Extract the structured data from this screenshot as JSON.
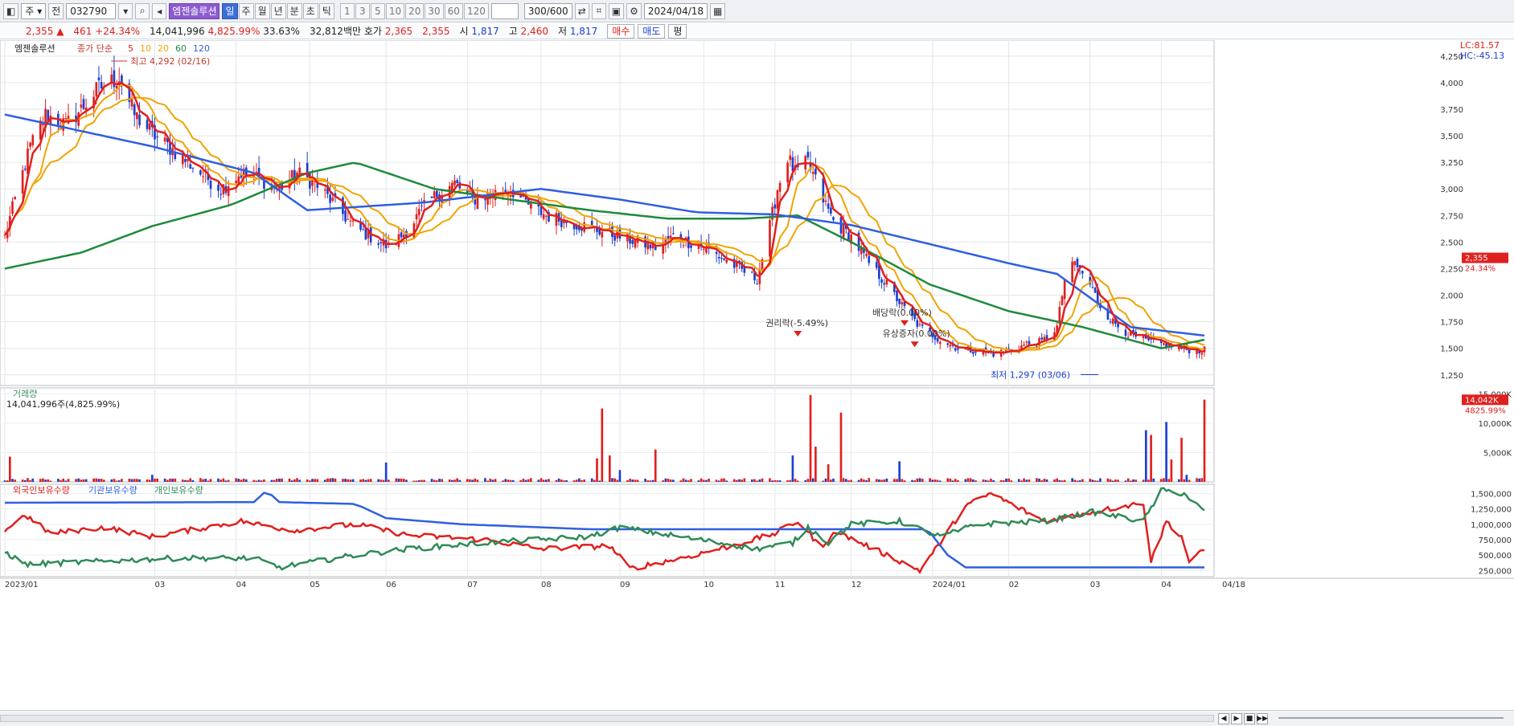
{
  "toolbar": {
    "period_label": "주",
    "compare_label": "전",
    "code": "032790",
    "stock_name": "엠젠솔루션",
    "period_tabs": [
      "일",
      "주",
      "월",
      "년",
      "분",
      "초",
      "틱"
    ],
    "interval_buttons": [
      "1",
      "3",
      "5",
      "10",
      "20",
      "30",
      "60",
      "120"
    ],
    "count": "300/600",
    "date": "2024/04/18"
  },
  "quote": {
    "price": "2,355",
    "change": "461",
    "change_pct": "+24.34%",
    "volume": "14,041,996",
    "volume_pct": "4,825.99%",
    "turnover": "33.63%",
    "amount": "32,812백만",
    "bid_label": "호가",
    "ask": "2,365",
    "bid": "2,355",
    "open_label": "시",
    "open": "1,817",
    "high_label": "고",
    "high": "2,460",
    "low_label": "저",
    "low": "1,817",
    "buy_label": "매수",
    "sell_label": "매도",
    "avg_label": "평"
  },
  "chart_data": [
    {
      "type": "candlestick",
      "panel": "price",
      "title": "엠젠솔루션",
      "legend": [
        {
          "name": "종가 단순",
          "color": "#c0392b"
        },
        {
          "name": "5",
          "color": "#e0201e"
        },
        {
          "name": "10",
          "color": "#f0a400"
        },
        {
          "name": "20",
          "color": "#f0a400"
        },
        {
          "name": "60",
          "color": "#1e8a3c"
        },
        {
          "name": "120",
          "color": "#2f5fe0"
        }
      ],
      "ylim": [
        1150,
        4400
      ],
      "yticks": [
        1250,
        1500,
        1750,
        2000,
        2250,
        2500,
        2750,
        3000,
        3250,
        3500,
        3750,
        4000,
        4250
      ],
      "ytick_labels": [
        "1,250",
        "1,500",
        "1,750",
        "2,000",
        "2,250",
        "2,500",
        "2,750",
        "3,000",
        "3,250",
        "3,500",
        "3,750",
        "4,000",
        "4,250"
      ],
      "x_labels": [
        "2023/01",
        "03",
        "04",
        "05",
        "06",
        "07",
        "08",
        "09",
        "10",
        "11",
        "12",
        "2024/01",
        "02",
        "03",
        "04",
        "04/18"
      ],
      "close_anchors": [
        [
          "2023-01-02",
          2550
        ],
        [
          "2023-01-06",
          2900
        ],
        [
          "2023-01-12",
          3400
        ],
        [
          "2023-01-18",
          3700
        ],
        [
          "2023-01-26",
          3600
        ],
        [
          "2023-02-01",
          3750
        ],
        [
          "2023-02-08",
          3950
        ],
        [
          "2023-02-16",
          4050
        ],
        [
          "2023-02-22",
          3700
        ],
        [
          "2023-03-02",
          3500
        ],
        [
          "2023-03-10",
          3350
        ],
        [
          "2023-03-20",
          3150
        ],
        [
          "2023-03-28",
          3000
        ],
        [
          "2023-04-05",
          3150
        ],
        [
          "2023-04-12",
          3100
        ],
        [
          "2023-04-20",
          3000
        ],
        [
          "2023-04-27",
          3150
        ],
        [
          "2023-05-04",
          3050
        ],
        [
          "2023-05-12",
          2850
        ],
        [
          "2023-05-19",
          2650
        ],
        [
          "2023-05-26",
          2550
        ],
        [
          "2023-06-02",
          2450
        ],
        [
          "2023-06-09",
          2600
        ],
        [
          "2023-06-15",
          2800
        ],
        [
          "2023-06-21",
          2950
        ],
        [
          "2023-06-28",
          3050
        ],
        [
          "2023-07-05",
          2900
        ],
        [
          "2023-07-12",
          2950
        ],
        [
          "2023-07-20",
          3000
        ],
        [
          "2023-07-27",
          2850
        ],
        [
          "2023-08-03",
          2750
        ],
        [
          "2023-08-10",
          2700
        ],
        [
          "2023-08-18",
          2650
        ],
        [
          "2023-08-25",
          2600
        ],
        [
          "2023-09-01",
          2550
        ],
        [
          "2023-09-08",
          2500
        ],
        [
          "2023-09-15",
          2450
        ],
        [
          "2023-09-22",
          2550
        ],
        [
          "2023-10-04",
          2450
        ],
        [
          "2023-10-11",
          2350
        ],
        [
          "2023-10-18",
          2250
        ],
        [
          "2023-10-25",
          2150
        ],
        [
          "2023-10-30",
          2650
        ],
        [
          "2023-11-02",
          3000
        ],
        [
          "2023-11-06",
          3300
        ],
        [
          "2023-11-09",
          3150
        ],
        [
          "2023-11-14",
          3250
        ],
        [
          "2023-11-20",
          2900
        ],
        [
          "2023-11-24",
          2700
        ],
        [
          "2023-12-01",
          2550
        ],
        [
          "2023-12-08",
          2300
        ],
        [
          "2023-12-15",
          2100
        ],
        [
          "2023-12-21",
          1900
        ],
        [
          "2023-12-28",
          1700
        ],
        [
          "2024-01-05",
          1580
        ],
        [
          "2024-01-12",
          1500
        ],
        [
          "2024-01-19",
          1480
        ],
        [
          "2024-01-26",
          1450
        ],
        [
          "2024-02-02",
          1480
        ],
        [
          "2024-02-08",
          1540
        ],
        [
          "2024-02-14",
          1560
        ],
        [
          "2024-02-20",
          1700
        ],
        [
          "2024-02-23",
          2150
        ],
        [
          "2024-02-27",
          2300
        ],
        [
          "2024-03-04",
          2100
        ],
        [
          "2024-03-08",
          1900
        ],
        [
          "2024-03-13",
          1750
        ],
        [
          "2024-03-20",
          1620
        ],
        [
          "2024-03-27",
          1560
        ],
        [
          "2024-04-03",
          1530
        ],
        [
          "2024-04-10",
          1490
        ],
        [
          "2024-04-17",
          1480
        ]
      ],
      "ma120_anchors": [
        [
          "2023-01-02",
          3700
        ],
        [
          "2023-03-01",
          3400
        ],
        [
          "2023-04-10",
          3150
        ],
        [
          "2023-05-01",
          2800
        ],
        [
          "2023-06-15",
          2870
        ],
        [
          "2023-08-01",
          3000
        ],
        [
          "2023-09-01",
          2900
        ],
        [
          "2023-10-01",
          2780
        ],
        [
          "2023-11-01",
          2760
        ],
        [
          "2023-12-01",
          2660
        ],
        [
          "2024-01-01",
          2480
        ],
        [
          "2024-02-01",
          2300
        ],
        [
          "2024-02-20",
          2200
        ],
        [
          "2024-03-20",
          1700
        ],
        [
          "2024-04-18",
          1620
        ]
      ],
      "ma60_anchors": [
        [
          "2023-01-02",
          2250
        ],
        [
          "2023-02-01",
          2400
        ],
        [
          "2023-03-01",
          2650
        ],
        [
          "2023-04-01",
          2850
        ],
        [
          "2023-05-01",
          3150
        ],
        [
          "2023-05-20",
          3250
        ],
        [
          "2023-06-20",
          3000
        ],
        [
          "2023-07-20",
          2900
        ],
        [
          "2023-08-20",
          2800
        ],
        [
          "2023-09-20",
          2720
        ],
        [
          "2023-10-20",
          2720
        ],
        [
          "2023-11-10",
          2750
        ],
        [
          "2023-12-01",
          2500
        ],
        [
          "2024-01-01",
          2100
        ],
        [
          "2024-02-01",
          1850
        ],
        [
          "2024-03-01",
          1700
        ],
        [
          "2024-04-01",
          1500
        ],
        [
          "2024-04-18",
          1580
        ]
      ],
      "annotations": [
        {
          "label": "최고 4,292 (02/16)",
          "date": "2023-02-16",
          "value": 4292
        },
        {
          "label": "권리락(-5.49%)",
          "date": "2023-11-10",
          "value": 1800
        },
        {
          "label": "배당락(0.00%)",
          "date": "2023-12-22",
          "value": 1900
        },
        {
          "label": "유상증자(0.00%)",
          "date": "2023-12-26",
          "value": 1700
        },
        {
          "label": "최저 1,297 (03/06)",
          "date": "2024-03-06",
          "value": 1297
        }
      ],
      "right_labels": [
        "LC:81.57",
        "HC:-45.13"
      ],
      "price_tag": "2,355",
      "price_tag_pct": "24.34%"
    },
    {
      "type": "bar",
      "panel": "volume",
      "title": "거래량",
      "subtitle": "14,041,996주(4,825.99%)",
      "ylim": [
        0,
        16000
      ],
      "yticks": [
        5000,
        10000,
        15000
      ],
      "ytick_labels": [
        "5,000K",
        "10,000K",
        "15,000K"
      ],
      "tag": "14,042K",
      "tag_pct": "4825.99%",
      "spikes": [
        [
          "2023-01-04",
          4300
        ],
        [
          "2023-03-01",
          1200
        ],
        [
          "2023-06-01",
          3300
        ],
        [
          "2023-08-23",
          4000
        ],
        [
          "2023-08-25",
          12500
        ],
        [
          "2023-08-28",
          4500
        ],
        [
          "2023-09-01",
          2000
        ],
        [
          "2023-09-15",
          5500
        ],
        [
          "2023-11-08",
          4500
        ],
        [
          "2023-11-15",
          14800
        ],
        [
          "2023-11-17",
          6000
        ],
        [
          "2023-11-22",
          3000
        ],
        [
          "2023-11-27",
          11800
        ],
        [
          "2023-12-10",
          2800
        ],
        [
          "2023-12-20",
          3500
        ],
        [
          "2024-03-26",
          8800
        ],
        [
          "2024-03-28",
          8000
        ],
        [
          "2024-04-03",
          10200
        ],
        [
          "2024-04-05",
          3800
        ],
        [
          "2024-04-09",
          7500
        ],
        [
          "2024-04-11",
          1200
        ],
        [
          "2024-04-18",
          14000
        ]
      ]
    },
    {
      "type": "line",
      "panel": "holdings",
      "series": [
        {
          "name": "외국인보유수량",
          "color": "#e0201e",
          "anchors": [
            [
              "2023-01-02",
              900000
            ],
            [
              "2023-01-10",
              1150000
            ],
            [
              "2023-01-20",
              850000
            ],
            [
              "2023-02-10",
              950000
            ],
            [
              "2023-03-01",
              800000
            ],
            [
              "2023-04-05",
              1050000
            ],
            [
              "2023-04-25",
              900000
            ],
            [
              "2023-05-20",
              1000000
            ],
            [
              "2023-06-10",
              820000
            ],
            [
              "2023-07-10",
              750000
            ],
            [
              "2023-08-01",
              600000
            ],
            [
              "2023-08-28",
              650000
            ],
            [
              "2023-09-05",
              280000
            ],
            [
              "2023-09-25",
              450000
            ],
            [
              "2023-10-15",
              650000
            ],
            [
              "2023-11-01",
              850000
            ],
            [
              "2023-11-10",
              1050000
            ],
            [
              "2023-11-20",
              600000
            ],
            [
              "2023-11-24",
              900000
            ],
            [
              "2023-12-10",
              600000
            ],
            [
              "2023-12-28",
              250000
            ],
            [
              "2024-01-05",
              700000
            ],
            [
              "2024-01-15",
              1300000
            ],
            [
              "2024-01-25",
              1500000
            ],
            [
              "2024-02-15",
              1050000
            ],
            [
              "2024-03-05",
              1200000
            ],
            [
              "2024-03-25",
              1350000
            ],
            [
              "2024-03-28",
              400000
            ],
            [
              "2024-04-03",
              1050000
            ],
            [
              "2024-04-09",
              800000
            ],
            [
              "2024-04-12",
              400000
            ],
            [
              "2024-04-18",
              580000
            ]
          ]
        },
        {
          "name": "기관보유수량",
          "color": "#2f5fe0",
          "anchors": [
            [
              "2023-01-02",
              1350000
            ],
            [
              "2023-04-10",
              1360000
            ],
            [
              "2023-04-15",
              1550000
            ],
            [
              "2023-04-20",
              1360000
            ],
            [
              "2023-05-20",
              1330000
            ],
            [
              "2023-06-01",
              1100000
            ],
            [
              "2023-07-01",
              1000000
            ],
            [
              "2023-08-20",
              920000
            ],
            [
              "2023-12-31",
              920000
            ],
            [
              "2024-01-08",
              500000
            ],
            [
              "2024-01-15",
              300000
            ],
            [
              "2024-03-26",
              300000
            ],
            [
              "2024-03-28",
              300000
            ],
            [
              "2024-04-18",
              300000
            ]
          ]
        },
        {
          "name": "개인보유수량",
          "color": "#2e8b57",
          "anchors": [
            [
              "2023-01-02",
              550000
            ],
            [
              "2023-01-10",
              350000
            ],
            [
              "2023-02-10",
              400000
            ],
            [
              "2023-03-10",
              450000
            ],
            [
              "2023-04-10",
              450000
            ],
            [
              "2023-04-20",
              300000
            ],
            [
              "2023-05-20",
              500000
            ],
            [
              "2023-06-10",
              600000
            ],
            [
              "2023-07-10",
              700000
            ],
            [
              "2023-08-20",
              800000
            ],
            [
              "2023-09-01",
              950000
            ],
            [
              "2023-10-10",
              700000
            ],
            [
              "2023-10-25",
              600000
            ],
            [
              "2023-11-08",
              700000
            ],
            [
              "2023-11-14",
              950000
            ],
            [
              "2023-11-22",
              700000
            ],
            [
              "2023-12-01",
              1000000
            ],
            [
              "2023-12-20",
              1050000
            ],
            [
              "2024-01-05",
              800000
            ],
            [
              "2024-01-20",
              1000000
            ],
            [
              "2024-02-15",
              1050000
            ],
            [
              "2024-03-05",
              1200000
            ],
            [
              "2024-03-25",
              1050000
            ],
            [
              "2024-04-01",
              1550000
            ],
            [
              "2024-04-10",
              1500000
            ],
            [
              "2024-04-18",
              1200000
            ]
          ]
        }
      ],
      "ylim": [
        150000,
        1650000
      ],
      "yticks": [
        250000,
        500000,
        750000,
        1000000,
        1250000,
        1500000
      ],
      "ytick_labels": [
        "250,000",
        "500,000",
        "750,000",
        "1,000,000",
        "1,250,000",
        "1,500,000"
      ]
    }
  ],
  "bottom_nav": {
    "scroll_controls": [
      "◀",
      "▶",
      "■",
      "▶▶"
    ]
  }
}
